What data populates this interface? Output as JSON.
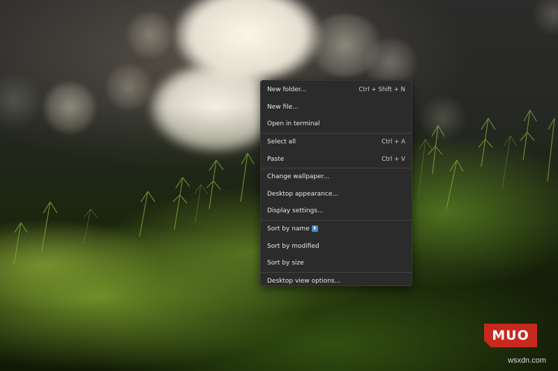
{
  "desktop": {
    "wallpaper": "moss bokeh photo",
    "watermark_logo": "MUO",
    "site_mark": "wsxdn.com"
  },
  "context_menu": {
    "groups": [
      [
        {
          "label": "New folder...",
          "shortcut": "Ctrl + Shift + N"
        },
        {
          "label": "New file...",
          "shortcut": ""
        },
        {
          "label": "Open in terminal",
          "shortcut": ""
        }
      ],
      [
        {
          "label": "Select all",
          "shortcut": "Ctrl + A"
        },
        {
          "label": "Paste",
          "shortcut": "Ctrl + V"
        }
      ],
      [
        {
          "label": "Change wallpaper...",
          "shortcut": ""
        },
        {
          "label": "Desktop appearance...",
          "shortcut": ""
        },
        {
          "label": "Display settings...",
          "shortcut": ""
        }
      ],
      [
        {
          "label": "Sort by name",
          "shortcut": "",
          "indicator": "⬇"
        },
        {
          "label": "Sort by modified",
          "shortcut": ""
        },
        {
          "label": "Sort by size",
          "shortcut": ""
        }
      ],
      [
        {
          "label": "Desktop view options...",
          "shortcut": ""
        }
      ]
    ]
  },
  "colors": {
    "menu_bg": "#2b2b2b",
    "menu_text": "#e8e8e8",
    "separator": "#414141",
    "logo_red": "#c8281e",
    "sort_indicator": "#4a8bd0"
  }
}
